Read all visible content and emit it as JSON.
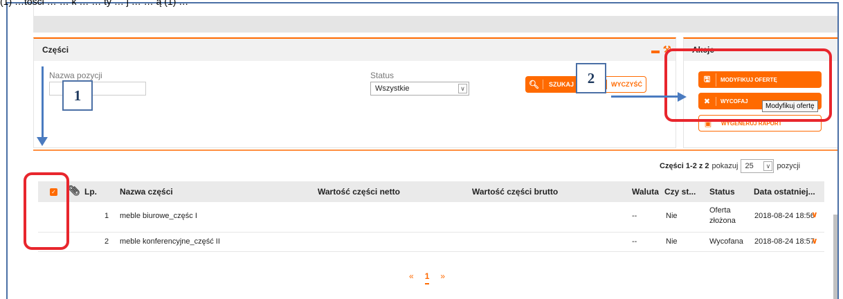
{
  "caption": "(1) …tości …     … k …  … ty … j …  … ą (1) …",
  "panel": {
    "title": "Części",
    "name_label": "Nazwa pozycji",
    "name_value": "",
    "status_label": "Status",
    "status_value": "Wszystkie",
    "search_label": "SZUKAJ",
    "clear_label": "WYCZYŚĆ"
  },
  "actions": {
    "title": "Akcje",
    "modify_label": "MODYFIKUJ OFERTĘ",
    "withdraw_label": "WYCOFAJ",
    "generate_label": "WYGENERUJ RAPORT",
    "tooltip": "Modyfikuj ofertę"
  },
  "table": {
    "pager_prefix": "Części 1-2 z 2",
    "pager_show": "pokazuj",
    "pager_size": "25",
    "pager_suffix": "pozycji",
    "headers": {
      "lp": "Lp.",
      "name": "Nazwa części",
      "net": "Wartość części netto",
      "gross": "Wartość części brutto",
      "currency": "Waluta",
      "czy": "Czy st...",
      "status": "Status",
      "date": "Data ostatniej..."
    },
    "rows": [
      {
        "lp": "1",
        "name": "meble biurowe_częśc I",
        "currency": "--",
        "czy": "Nie",
        "status_1": "Oferta",
        "status_2": "złożona",
        "date": "2018-08-24 18:56"
      },
      {
        "lp": "2",
        "name": "meble konferencyjne_część II",
        "currency": "--",
        "czy": "Nie",
        "status_1": "Wycofana",
        "status_2": "",
        "date": "2018-08-24 18:57"
      }
    ]
  },
  "pagination": {
    "prev": "«",
    "current": "1",
    "next": "»"
  },
  "callouts": {
    "one": "1",
    "two": "2"
  },
  "colors": {
    "accent": "#ff6a00",
    "annotation_red": "#e8262d",
    "annotation_blue": "#4a7bc0"
  }
}
